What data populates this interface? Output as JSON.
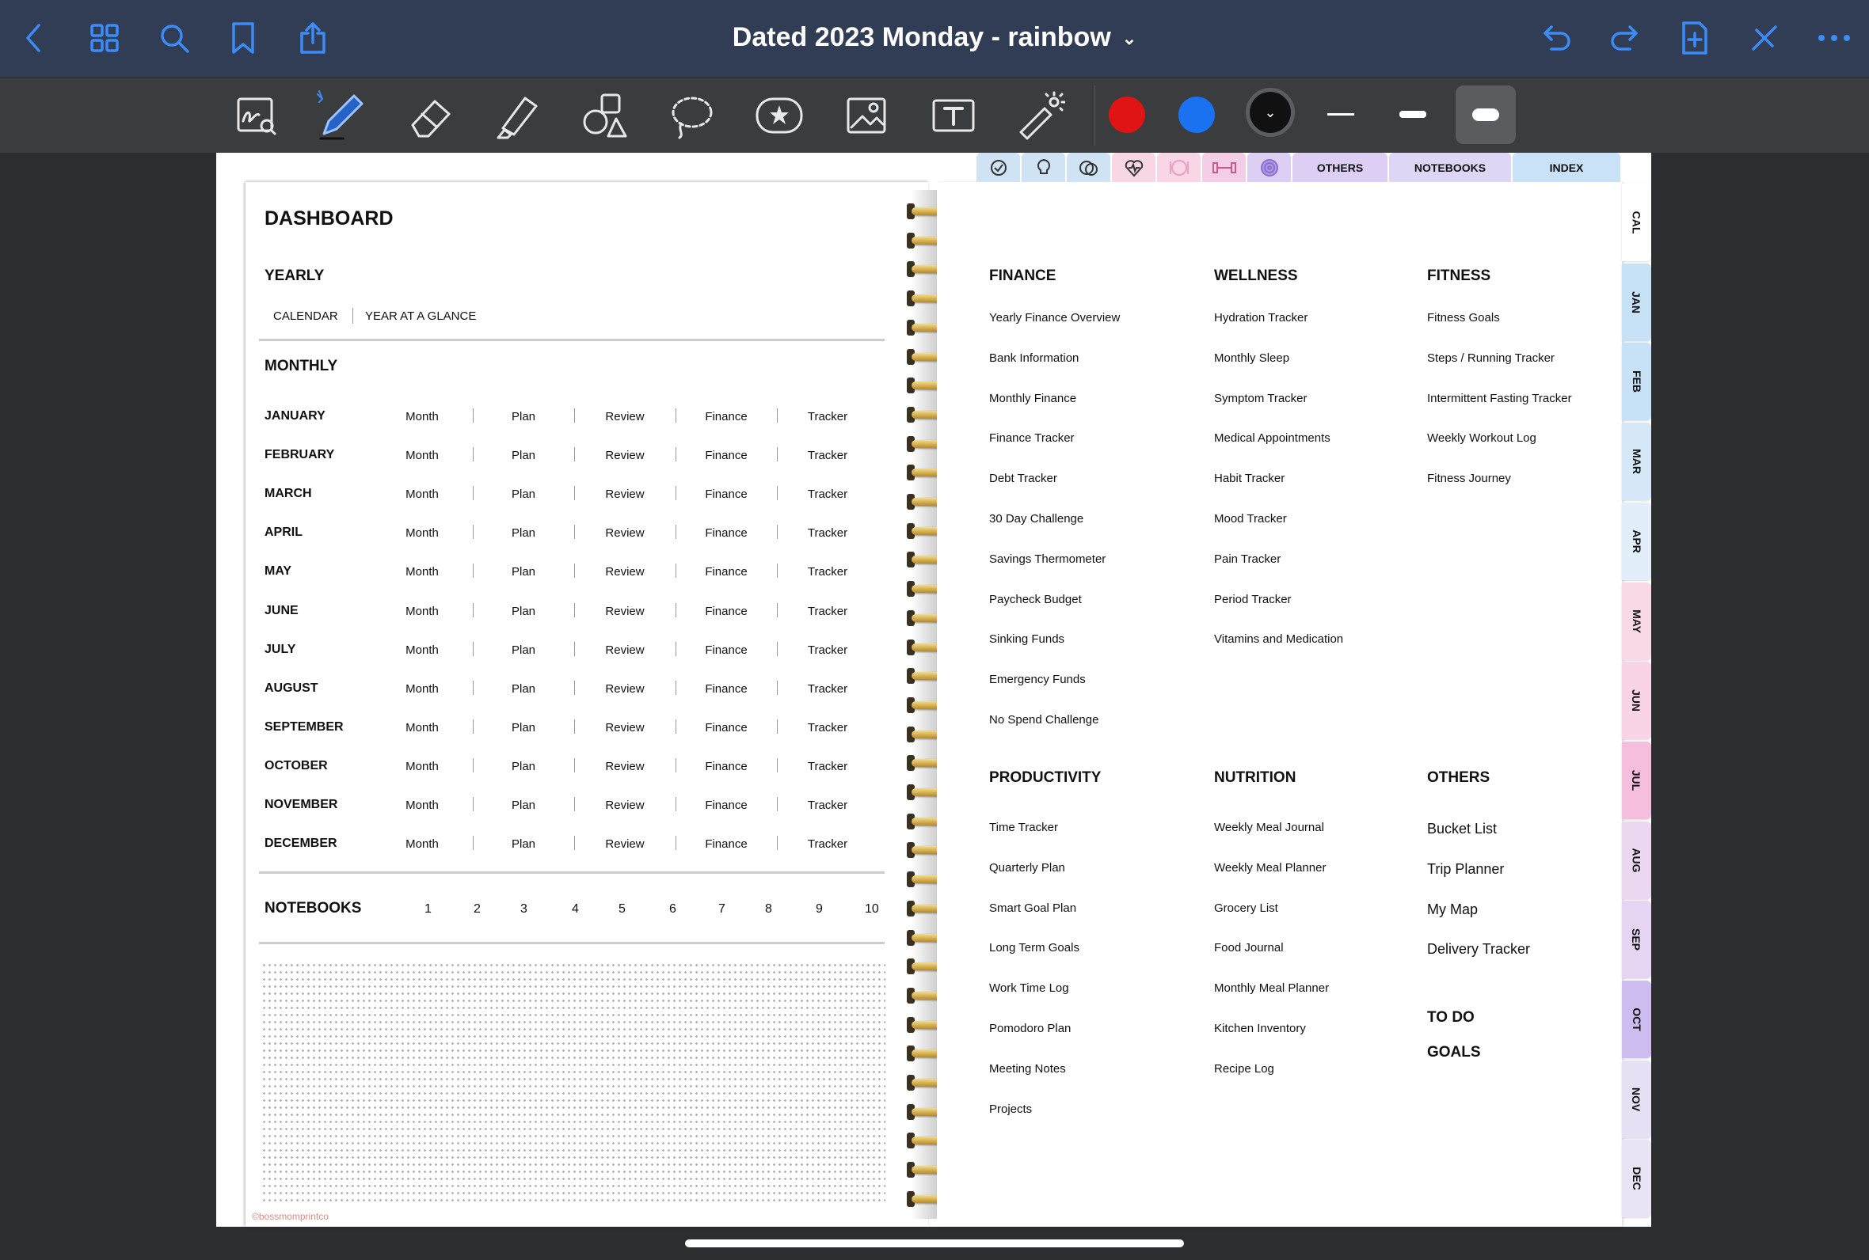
{
  "app": {
    "title": "Dated 2023 Monday - rainbow",
    "icons": [
      "back-icon",
      "grid-icon",
      "search-icon",
      "bookmark-icon",
      "share-icon",
      "undo-icon",
      "redo-icon",
      "add-page-icon",
      "close-icon",
      "more-icon"
    ],
    "accent": "#3b8cf7",
    "topbar_color": "#313d54"
  },
  "tools": {
    "items": [
      "zoom-write-tool",
      "pen-tool",
      "eraser-tool",
      "highlighter-tool",
      "shapes-tool",
      "lasso-tool",
      "sticker-tool",
      "image-tool",
      "text-tool",
      "laser-tool"
    ],
    "colors": [
      "#e01414",
      "#1a72f2",
      "#111111"
    ]
  },
  "dashboard": {
    "title": "DASHBOARD",
    "yearly": {
      "heading": "YEARLY",
      "links": [
        "CALENDAR",
        "YEAR AT A GLANCE"
      ]
    },
    "monthly": {
      "heading": "MONTHLY",
      "columns": [
        "Month",
        "Plan",
        "Review",
        "Finance",
        "Tracker"
      ],
      "months": [
        "JANUARY",
        "FEBRUARY",
        "MARCH",
        "APRIL",
        "MAY",
        "JUNE",
        "JULY",
        "AUGUST",
        "SEPTEMBER",
        "OCTOBER",
        "NOVEMBER",
        "DECEMBER"
      ]
    },
    "notebooks": {
      "heading": "NOTEBOOKS",
      "numbers": [
        "1",
        "2",
        "3",
        "4",
        "5",
        "6",
        "7",
        "8",
        "9",
        "10"
      ]
    },
    "watermark": "©bossmomprintco"
  },
  "index": {
    "columns": [
      {
        "heading": "FINANCE",
        "items": [
          "Yearly Finance Overview",
          "Bank Information",
          "Monthly Finance",
          "Finance Tracker",
          "Debt Tracker",
          "30 Day Challenge",
          "Savings Thermometer",
          "Paycheck Budget",
          "Sinking Funds",
          "Emergency Funds",
          "No Spend Challenge"
        ]
      },
      {
        "heading": "WELLNESS",
        "items": [
          "Hydration Tracker",
          "Monthly Sleep",
          "Symptom Tracker",
          "Medical Appointments",
          "Habit Tracker",
          "Mood Tracker",
          "Pain Tracker",
          "Period Tracker",
          "Vitamins and Medication"
        ]
      },
      {
        "heading": "FITNESS",
        "items": [
          "Fitness Goals",
          "Steps / Running Tracker",
          "Intermittent Fasting Tracker",
          "Weekly Workout Log",
          "Fitness Journey"
        ]
      },
      {
        "heading": "PRODUCTIVITY",
        "items": [
          "Time Tracker",
          "Quarterly Plan",
          "Smart Goal Plan",
          "Long Term Goals",
          "Work Time Log",
          "Pomodoro Plan",
          "Meeting Notes",
          "Projects"
        ]
      },
      {
        "heading": "NUTRITION",
        "items": [
          "Weekly Meal Journal",
          "Weekly Meal Planner",
          "Grocery List",
          "Food Journal",
          "Monthly Meal Planner",
          "Kitchen Inventory",
          "Recipe Log"
        ]
      },
      {
        "heading": "OTHERS",
        "items": [
          "Bucket List",
          "Trip Planner",
          "My Map",
          "Delivery Tracker"
        ]
      }
    ],
    "extra_headings": [
      "TO DO",
      "GOALS"
    ]
  },
  "tabs": {
    "top": [
      {
        "icon": "checkmark-icon",
        "color": "#cfe3f5"
      },
      {
        "icon": "lightbulb-icon",
        "color": "#cfe3f5"
      },
      {
        "icon": "coins-icon",
        "color": "#cfe3f5"
      },
      {
        "icon": "heart-pulse-icon",
        "color": "#f8d6e6"
      },
      {
        "icon": "plate-icon",
        "color": "#f8d6e6"
      },
      {
        "icon": "dumbbell-icon",
        "color": "#f4cde6"
      },
      {
        "icon": "fingerprint-icon",
        "color": "#dccff3"
      },
      {
        "label": "OTHERS",
        "color": "#dccff3"
      },
      {
        "label": "NOTEBOOKS",
        "color": "#ddd7f5"
      },
      {
        "label": "INDEX",
        "color": "#c9e2f7"
      }
    ],
    "side": [
      {
        "label": "CAL",
        "color": "#ffffff"
      },
      {
        "label": "JAN",
        "color": "#c7e1f7"
      },
      {
        "label": "FEB",
        "color": "#c7e1f7"
      },
      {
        "label": "MAR",
        "color": "#d6e8f7"
      },
      {
        "label": "APR",
        "color": "#e2eefa"
      },
      {
        "label": "MAY",
        "color": "#f9d9e8"
      },
      {
        "label": "JUN",
        "color": "#f9d3e6"
      },
      {
        "label": "JUL",
        "color": "#f6bedd"
      },
      {
        "label": "AUG",
        "color": "#ecd7f1"
      },
      {
        "label": "SEP",
        "color": "#e6d5f2"
      },
      {
        "label": "OCT",
        "color": "#cdbcef"
      },
      {
        "label": "NOV",
        "color": "#e6e0f5"
      },
      {
        "label": "DEC",
        "color": "#e9e4f5"
      }
    ]
  }
}
